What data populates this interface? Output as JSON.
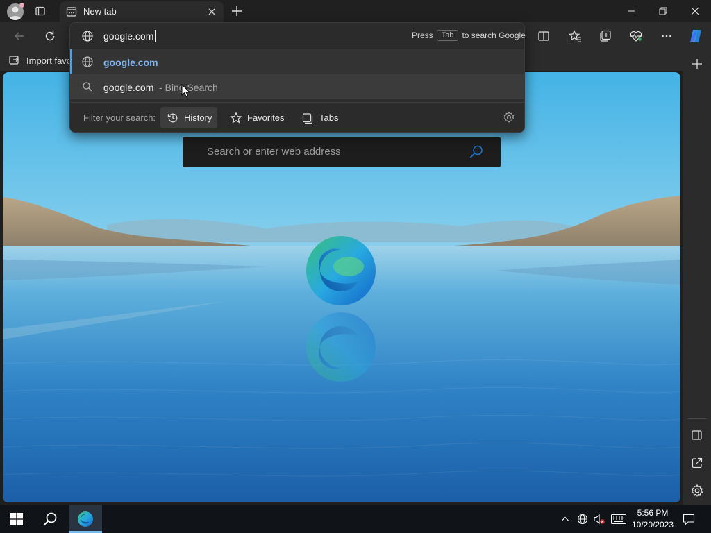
{
  "tab": {
    "title": "New tab"
  },
  "favorites_bar": {
    "import_label": "Import favo"
  },
  "address": {
    "value": "google.com",
    "hint_press": "Press",
    "hint_key": "Tab",
    "hint_rest": "to search Google"
  },
  "suggestions": [
    {
      "text": "google.com",
      "icon": "globe-icon"
    },
    {
      "text": "google.com",
      "suffix": "- Bing Search",
      "icon": "search-icon"
    }
  ],
  "filter": {
    "label": "Filter your search:",
    "chips": [
      {
        "label": "History",
        "icon": "history-icon",
        "selected": true
      },
      {
        "label": "Favorites",
        "icon": "star-icon",
        "selected": false
      },
      {
        "label": "Tabs",
        "icon": "tabs-icon",
        "selected": false
      }
    ]
  },
  "ntp": {
    "search_placeholder": "Search or enter web address"
  },
  "taskbar": {
    "time": "5:56 PM",
    "date": "10/20/2023"
  },
  "colors": {
    "accent": "#0078d4",
    "suggestion_link": "#7fb4f0",
    "chrome": "#2b2b2b",
    "titlebar": "#202020"
  }
}
